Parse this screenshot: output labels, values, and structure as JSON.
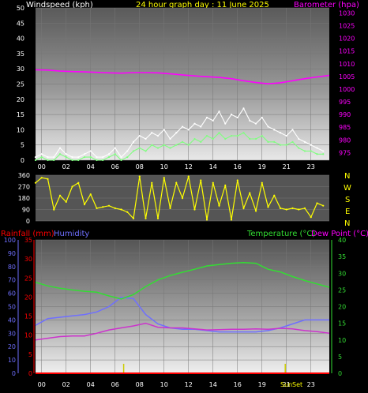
{
  "header": {
    "wind_label": "Windspeed (kph)",
    "title": "24 hour graph day : 11 June 2025",
    "baro_label": "Barometer (hpa)"
  },
  "lower_header": {
    "rain_label": "Rainfall (mm)",
    "humidity_label": "Humidity",
    "temp_label": "Temperature (°C)",
    "dew_label": "Dew Point (°C)"
  },
  "compass_letters": [
    "N",
    "W",
    "S",
    "E",
    "N"
  ],
  "sun_labels": {
    "sunrise": "Sun",
    "sunset": "Set"
  },
  "colors": {
    "wind": "#ffffff",
    "gust": "#7fff7f",
    "barometer": "#ff00ff",
    "wind_dir": "#ffff00",
    "rainfall": "#ff0000",
    "humidity": "#6f6fff",
    "temperature": "#33dd33",
    "dewpoint": "#cc33cc",
    "title": "#ffff00",
    "label_white": "#ffffff",
    "compass": "#ffff00"
  },
  "chart_data": [
    {
      "type": "line",
      "title": "24 hour graph day : 11 June 2025",
      "x_ticks": [
        "00",
        "02",
        "04",
        "06",
        "08",
        "10",
        "12",
        "14",
        "16",
        "19",
        "21",
        "23"
      ],
      "left_axis": {
        "label": "Windspeed (kph)",
        "ticks": [
          0,
          5,
          10,
          15,
          20,
          25,
          30,
          35,
          40,
          45,
          50
        ],
        "range": [
          0,
          50
        ]
      },
      "right_axis": {
        "label": "Barometer (hpa)",
        "ticks": [
          975,
          980,
          985,
          990,
          995,
          1000,
          1005,
          1010,
          1015,
          1020,
          1025,
          1030
        ],
        "range": [
          972,
          1032
        ]
      },
      "series": [
        {
          "name": "Windspeed (kph)",
          "axis": "left",
          "x": [
            0,
            0.5,
            1,
            1.5,
            2,
            2.5,
            3,
            3.5,
            4,
            4.5,
            5,
            5.5,
            6,
            6.5,
            7,
            7.5,
            8,
            8.5,
            9,
            9.5,
            10,
            10.5,
            11,
            11.5,
            12,
            12.5,
            13,
            13.5,
            14,
            14.5,
            15,
            15.5,
            16,
            16.5,
            17,
            17.5,
            18,
            18.5,
            19,
            19.5,
            20,
            20.5,
            21,
            21.5,
            22,
            22.5,
            23,
            23.5
          ],
          "values": [
            1,
            2,
            1,
            1,
            4,
            2,
            1,
            1,
            2,
            3,
            1,
            1,
            2,
            4,
            1,
            3,
            6,
            8,
            7,
            9,
            8,
            10,
            7,
            9,
            11,
            10,
            12,
            11,
            14,
            13,
            16,
            12,
            15,
            14,
            17,
            13,
            12,
            14,
            11,
            10,
            9,
            8,
            10,
            7,
            6,
            5,
            4,
            3
          ]
        },
        {
          "name": "Gust (kph)",
          "axis": "left",
          "x": [
            0,
            0.5,
            1,
            1.5,
            2,
            2.5,
            3,
            3.5,
            4,
            4.5,
            5,
            5.5,
            6,
            6.5,
            7,
            7.5,
            8,
            8.5,
            9,
            9.5,
            10,
            10.5,
            11,
            11.5,
            12,
            12.5,
            13,
            13.5,
            14,
            14.5,
            15,
            15.5,
            16,
            16.5,
            17,
            17.5,
            18,
            18.5,
            19,
            19.5,
            20,
            20.5,
            21,
            21.5,
            22,
            22.5,
            23,
            23.5
          ],
          "values": [
            0,
            1,
            0,
            0,
            2,
            1,
            0,
            0,
            1,
            1,
            0,
            0,
            1,
            2,
            0,
            1,
            3,
            4,
            3,
            5,
            4,
            5,
            4,
            5,
            6,
            5,
            7,
            6,
            8,
            7,
            9,
            7,
            8,
            8,
            9,
            7,
            7,
            8,
            6,
            6,
            5,
            5,
            6,
            4,
            3,
            3,
            2,
            2
          ]
        },
        {
          "name": "Barometer (hpa)",
          "axis": "right",
          "x": [
            0,
            1,
            2,
            3,
            4,
            5,
            6,
            7,
            8,
            9,
            10,
            11,
            12,
            13,
            14,
            15,
            16,
            17,
            18,
            19,
            20,
            21,
            22,
            23,
            24
          ],
          "values": [
            1007.6,
            1007.5,
            1007.1,
            1006.9,
            1006.8,
            1006.6,
            1006.4,
            1006.3,
            1006.5,
            1006.5,
            1006.4,
            1006.0,
            1005.6,
            1005.2,
            1004.9,
            1004.6,
            1004.1,
            1003.3,
            1002.6,
            1002.1,
            1002.5,
            1003.3,
            1004.1,
            1004.8,
            1005.4
          ]
        }
      ]
    },
    {
      "type": "line",
      "title": "",
      "y_range": [
        0,
        360
      ],
      "y_ticks": [
        0,
        90,
        180,
        270,
        360
      ],
      "series": [
        {
          "name": "Wind direction",
          "x": [
            0,
            0.5,
            1,
            1.5,
            2,
            2.5,
            3,
            3.5,
            4,
            4.5,
            5,
            5.5,
            6,
            6.5,
            7,
            7.5,
            8,
            8.5,
            9,
            9.5,
            10,
            10.5,
            11,
            11.5,
            12,
            12.5,
            13,
            13.5,
            14,
            14.5,
            15,
            15.5,
            16,
            16.5,
            17,
            17.5,
            18,
            18.5,
            19,
            19.5,
            20,
            20.5,
            21,
            21.5,
            22,
            22.5,
            23,
            23.5
          ],
          "values": [
            300,
            340,
            330,
            90,
            200,
            150,
            270,
            300,
            130,
            210,
            100,
            110,
            120,
            100,
            90,
            70,
            20,
            350,
            20,
            300,
            20,
            340,
            100,
            300,
            180,
            350,
            90,
            320,
            10,
            300,
            120,
            280,
            10,
            320,
            100,
            220,
            80,
            300,
            110,
            200,
            100,
            90,
            100,
            90,
            100,
            30,
            140,
            120
          ]
        }
      ]
    },
    {
      "type": "line",
      "title": "",
      "x_ticks": [
        "00",
        "02",
        "04",
        "06",
        "08",
        "10",
        "12",
        "14",
        "16",
        "19",
        "21",
        "23"
      ],
      "humidity_axis": {
        "label": "Humidity",
        "ticks": [
          0,
          10,
          20,
          30,
          40,
          50,
          60,
          70,
          80,
          90,
          100
        ],
        "range": [
          0,
          100
        ]
      },
      "rainfall_axis": {
        "label": "Rainfall (mm)",
        "ticks": [
          0,
          5,
          10,
          15,
          20,
          25,
          30,
          35
        ],
        "range": [
          0,
          35
        ]
      },
      "temperature_axis": {
        "label": "Temperature (°C)",
        "ticks": [
          0,
          5,
          10,
          15,
          20,
          25,
          30,
          35,
          40
        ],
        "range": [
          0,
          40
        ]
      },
      "series": [
        {
          "name": "Humidity",
          "axis": "humidity",
          "x": [
            0,
            1,
            2,
            3,
            4,
            5,
            6,
            7,
            8,
            9,
            10,
            11,
            12,
            13,
            14,
            15,
            16,
            17,
            18,
            19,
            20,
            21,
            22,
            23,
            24
          ],
          "values": [
            36,
            41,
            42,
            43,
            44,
            46,
            50,
            57,
            56,
            44,
            37,
            34,
            33,
            33,
            32,
            31,
            31,
            31,
            31,
            32,
            34,
            37,
            40,
            40,
            40
          ]
        },
        {
          "name": "Temperature (°C)",
          "axis": "temperature",
          "x": [
            0,
            1,
            2,
            3,
            4,
            5,
            6,
            7,
            8,
            9,
            10,
            11,
            12,
            13,
            14,
            15,
            16,
            17,
            18,
            19,
            20,
            21,
            22,
            23,
            24
          ],
          "values": [
            27.3,
            26.2,
            25.5,
            25.0,
            24.6,
            24.3,
            23.2,
            22.3,
            23.6,
            26.0,
            28.0,
            29.3,
            30.3,
            31.2,
            32.2,
            32.6,
            33.0,
            33.2,
            33.0,
            31.2,
            30.4,
            29.0,
            27.8,
            26.8,
            25.8
          ]
        },
        {
          "name": "Dew Point (°C)",
          "axis": "temperature",
          "x": [
            0,
            1,
            2,
            3,
            4,
            5,
            6,
            7,
            8,
            9,
            10,
            11,
            12,
            13,
            14,
            15,
            16,
            17,
            18,
            19,
            20,
            21,
            22,
            23,
            24
          ],
          "values": [
            10.0,
            10.5,
            11.0,
            11.2,
            11.2,
            12.0,
            13.0,
            13.6,
            14.2,
            15.0,
            13.8,
            13.6,
            13.6,
            13.3,
            13.0,
            13.1,
            13.2,
            13.2,
            13.3,
            13.2,
            13.5,
            13.3,
            12.8,
            12.5,
            12.0
          ]
        },
        {
          "name": "Rainfall (mm)",
          "axis": "rainfall",
          "x": [
            0,
            24
          ],
          "values": [
            0,
            0
          ]
        }
      ]
    }
  ]
}
